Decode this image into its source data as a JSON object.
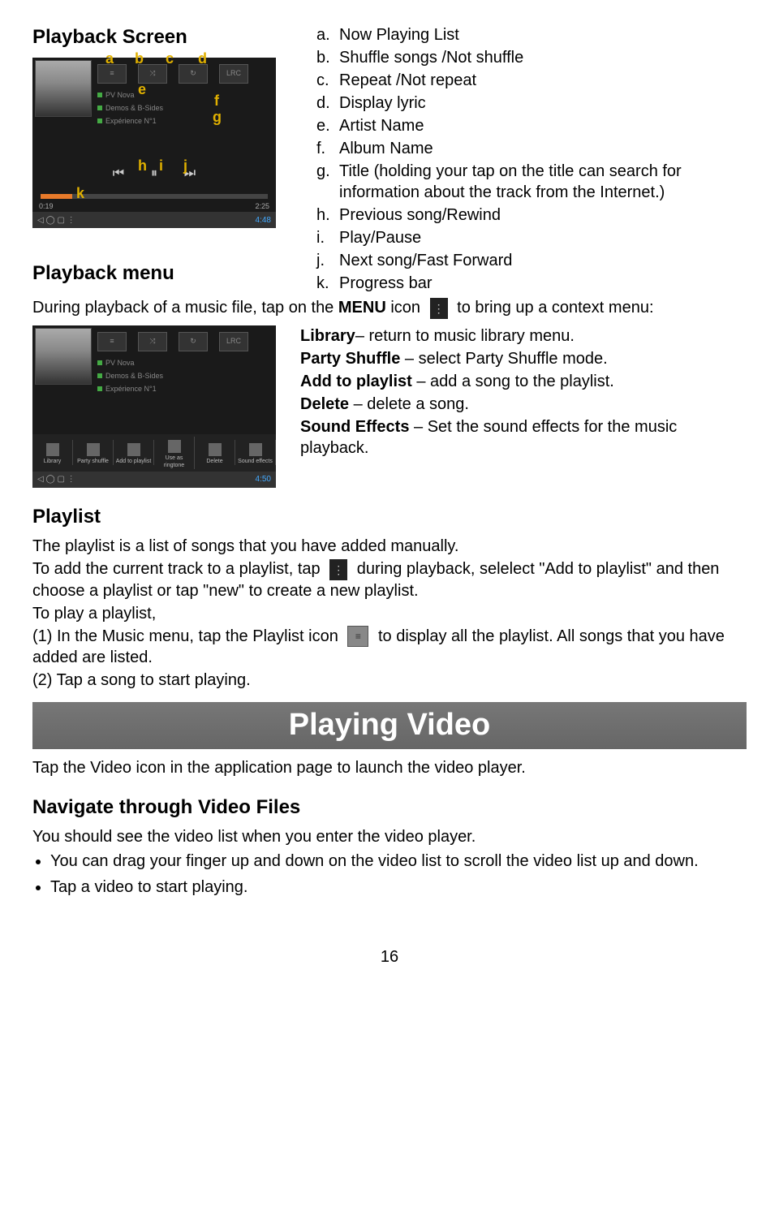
{
  "section1": {
    "title": "Playback Screen"
  },
  "fig1": {
    "anno": {
      "a": "a",
      "b": "b",
      "c": "c",
      "d": "d",
      "e": "e",
      "f": "f",
      "g": "g",
      "h": "h",
      "i": "i",
      "j": "j",
      "k": "k"
    },
    "track1": "PV Nova",
    "track2": "Demos & B-Sides",
    "track3": "Expérience N°1",
    "lrc": "LRC",
    "time_left": "0:19",
    "time_right": "2:25",
    "clock": "4:48"
  },
  "legend": {
    "a": {
      "key": "a.",
      "val": "Now Playing List"
    },
    "b": {
      "key": "b.",
      "val": "Shuffle songs /Not shuffle"
    },
    "c": {
      "key": "c.",
      "val": "Repeat /Not repeat"
    },
    "d": {
      "key": "d.",
      "val": "Display lyric"
    },
    "e": {
      "key": "e.",
      "val": "Artist Name"
    },
    "f": {
      "key": "f.",
      "val": "Album Name"
    },
    "g": {
      "key": "g.",
      "val": "Title (holding your tap on the title can search for information about the track from the Internet.)"
    },
    "h": {
      "key": "h.",
      "val": "Previous song/Rewind"
    },
    "i": {
      "key": "i.",
      "val": "Play/Pause"
    },
    "j": {
      "key": "j.",
      "val": "Next song/Fast Forward"
    },
    "k": {
      "key": "k.",
      "val": "Progress bar"
    }
  },
  "section2": {
    "title": "Playback menu",
    "text_before": "During playback of a music file, tap on the ",
    "text_bold": "MENU",
    "text_mid": " icon ",
    "text_after": " to bring up a context menu:"
  },
  "fig2": {
    "menu": {
      "m1": "Library",
      "m2": "Party shuffle",
      "m3": "Add to playlist",
      "m4": "Use as ringtone",
      "m5": "Delete",
      "m6": "Sound effects"
    },
    "clock": "4:50"
  },
  "menu_desc": {
    "l1": {
      "term": "Library",
      "text": "– return to music library menu."
    },
    "l2": {
      "term": "Party Shuffle",
      "text": " – select Party Shuffle mode."
    },
    "l3": {
      "term": "Add to playlist",
      "text": " – add a song to the playlist."
    },
    "l4": {
      "term": "Delete",
      "text": " – delete a song."
    },
    "l5": {
      "term": "Sound Effects",
      "text": " – Set the sound effects for the music playback."
    }
  },
  "section3": {
    "title": "Playlist",
    "p1": "The playlist is a list of songs that you have added manually.",
    "p2a": "To add the current track to a playlist, tap ",
    "p2b": " during playback, selelect \"Add to playlist\" and then choose a playlist or tap \"new\" to create a new playlist.",
    "p3": "To play a playlist,",
    "p4a": "(1) In the Music menu, tap the Playlist icon ",
    "p4b": " to display all the playlist. All songs that you have added are listed.",
    "p5": "(2) Tap a song to start playing."
  },
  "section4": {
    "banner": "Playing Video",
    "p1": "Tap the Video icon in the application page to launch the video player.",
    "h2": "Navigate through Video Files",
    "p2": "You should see the video list when you enter the video player.",
    "b1": "You can drag your finger up and down on the video list to scroll the video list up and down.",
    "b2": "Tap a video to start playing."
  },
  "page_num": "16"
}
